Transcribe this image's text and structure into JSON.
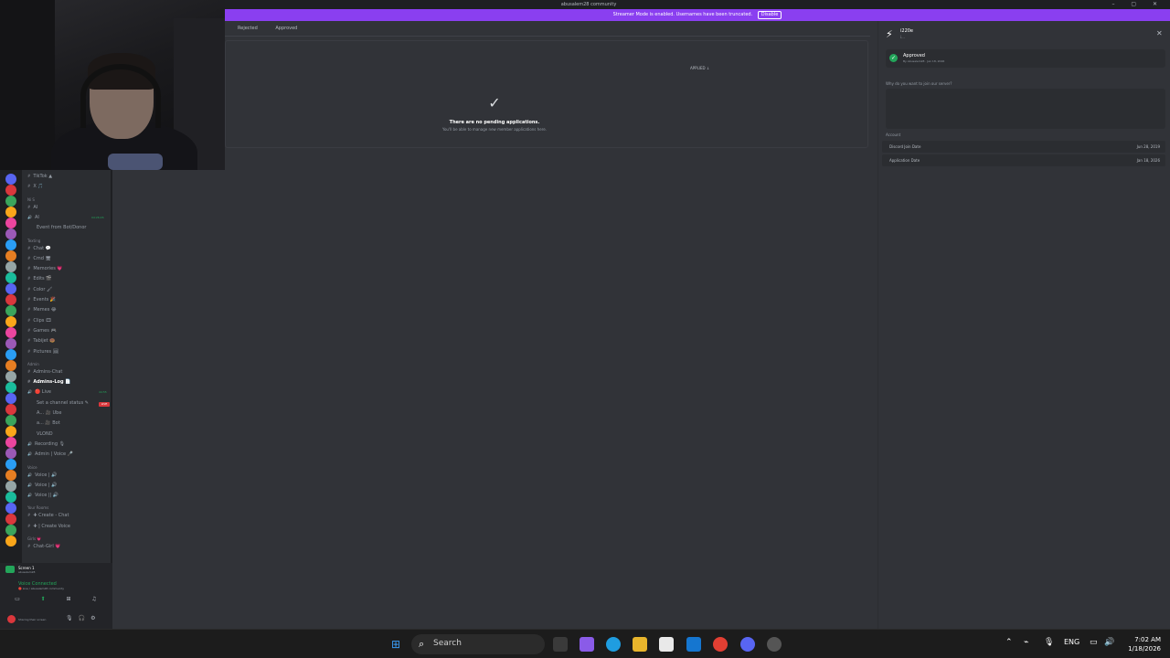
{
  "title_bar": {
    "title": "abusalem28 community",
    "window_controls": "– ▢ ✕"
  },
  "banner": {
    "text": "Streamer Mode is enabled. Usernames have been truncated.",
    "button": "Disable"
  },
  "tabs": [
    "Rejected",
    "Approved"
  ],
  "sort_label": "APPLIED ↓",
  "empty_state": {
    "check": "✓",
    "title": "There are no pending applications.",
    "subtitle": "You'll be able to manage new member applications here."
  },
  "channels": [
    {
      "t": "channel",
      "label": "TikTok ▲"
    },
    {
      "t": "channel",
      "label": "X 🎵"
    },
    {
      "t": "cat",
      "label": "N⁠i⁠ S"
    },
    {
      "t": "channel",
      "label": "AI"
    },
    {
      "t": "voice",
      "label": "AI"
    },
    {
      "t": "sub",
      "label": "Event from Bot/Donor"
    },
    {
      "t": "cat",
      "label": "Texting"
    },
    {
      "t": "channel",
      "label": "Chat 💬"
    },
    {
      "t": "channel",
      "label": "Cmd 🖥"
    },
    {
      "t": "channel",
      "label": "Memories 💗"
    },
    {
      "t": "channel",
      "label": "Edits 🎬"
    },
    {
      "t": "channel",
      "label": "Color 🖌"
    },
    {
      "t": "channel",
      "label": "Events 🎉"
    },
    {
      "t": "channel",
      "label": "Memes 😂"
    },
    {
      "t": "channel",
      "label": "Clips 🎞"
    },
    {
      "t": "channel",
      "label": "Games 🎮"
    },
    {
      "t": "channel",
      "label": "Tabijet 🍩"
    },
    {
      "t": "channel",
      "label": "Pictures 🖼"
    },
    {
      "t": "cat",
      "label": "Admin"
    },
    {
      "t": "channel",
      "label": "Admins-Chat"
    },
    {
      "t": "active",
      "label": "Admins-Log 📄"
    },
    {
      "t": "voice",
      "label": "🔴 Live"
    },
    {
      "t": "sub",
      "label": "Set a channel status ✎"
    },
    {
      "t": "sub",
      "label": "A... 🎥 Ube"
    },
    {
      "t": "sub",
      "label": "a... 🎥 Bot"
    },
    {
      "t": "sub",
      "label": "VLOND"
    },
    {
      "t": "voice",
      "label": "Recording 🎙"
    },
    {
      "t": "voice",
      "label": "Admin | Voice 🎤"
    },
    {
      "t": "cat",
      "label": "Voice"
    },
    {
      "t": "voice",
      "label": "Voice | 🔊"
    },
    {
      "t": "voice",
      "label": "Voice | 🔊"
    },
    {
      "t": "voice",
      "label": "Voice || 🔊"
    },
    {
      "t": "cat",
      "label": "Your Rooms"
    },
    {
      "t": "channel",
      "label": "✚ Create - Chat"
    },
    {
      "t": "channel",
      "label": "✚ | Create Voice"
    },
    {
      "t": "cat",
      "label": "Girls 💗"
    },
    {
      "t": "channel",
      "label": "Chat-Girl 💗"
    }
  ],
  "live_badge": "LIVE",
  "voice_counts": [
    "04:26:26",
    "44:55"
  ],
  "voice_panel": {
    "stream_name": "Screen 1",
    "stream_sub": "abusalem28",
    "status": "Voice Connected",
    "server": "🔴 Live / abusalem28 community",
    "user_status": "Sharing their screen"
  },
  "profile": {
    "name": "i220e",
    "sub": "i...",
    "approved_label": "Approved",
    "approved_by": "By Abusalem28 · Jan 18, 2026",
    "question": "Why do you want to join our server?",
    "section": "Account",
    "rows": [
      {
        "k": "Discord Join Date",
        "v": "Jun 28, 2019"
      },
      {
        "k": "Application Date",
        "v": "Jan 18, 2026"
      }
    ]
  },
  "taskbar": {
    "search": "Search",
    "lang": "ENG",
    "time": "7:02 AM",
    "date": "1/18/2026"
  },
  "colors": {
    "accent": "#8a3ff0",
    "approved": "#23a55a",
    "live": "#da373c"
  }
}
